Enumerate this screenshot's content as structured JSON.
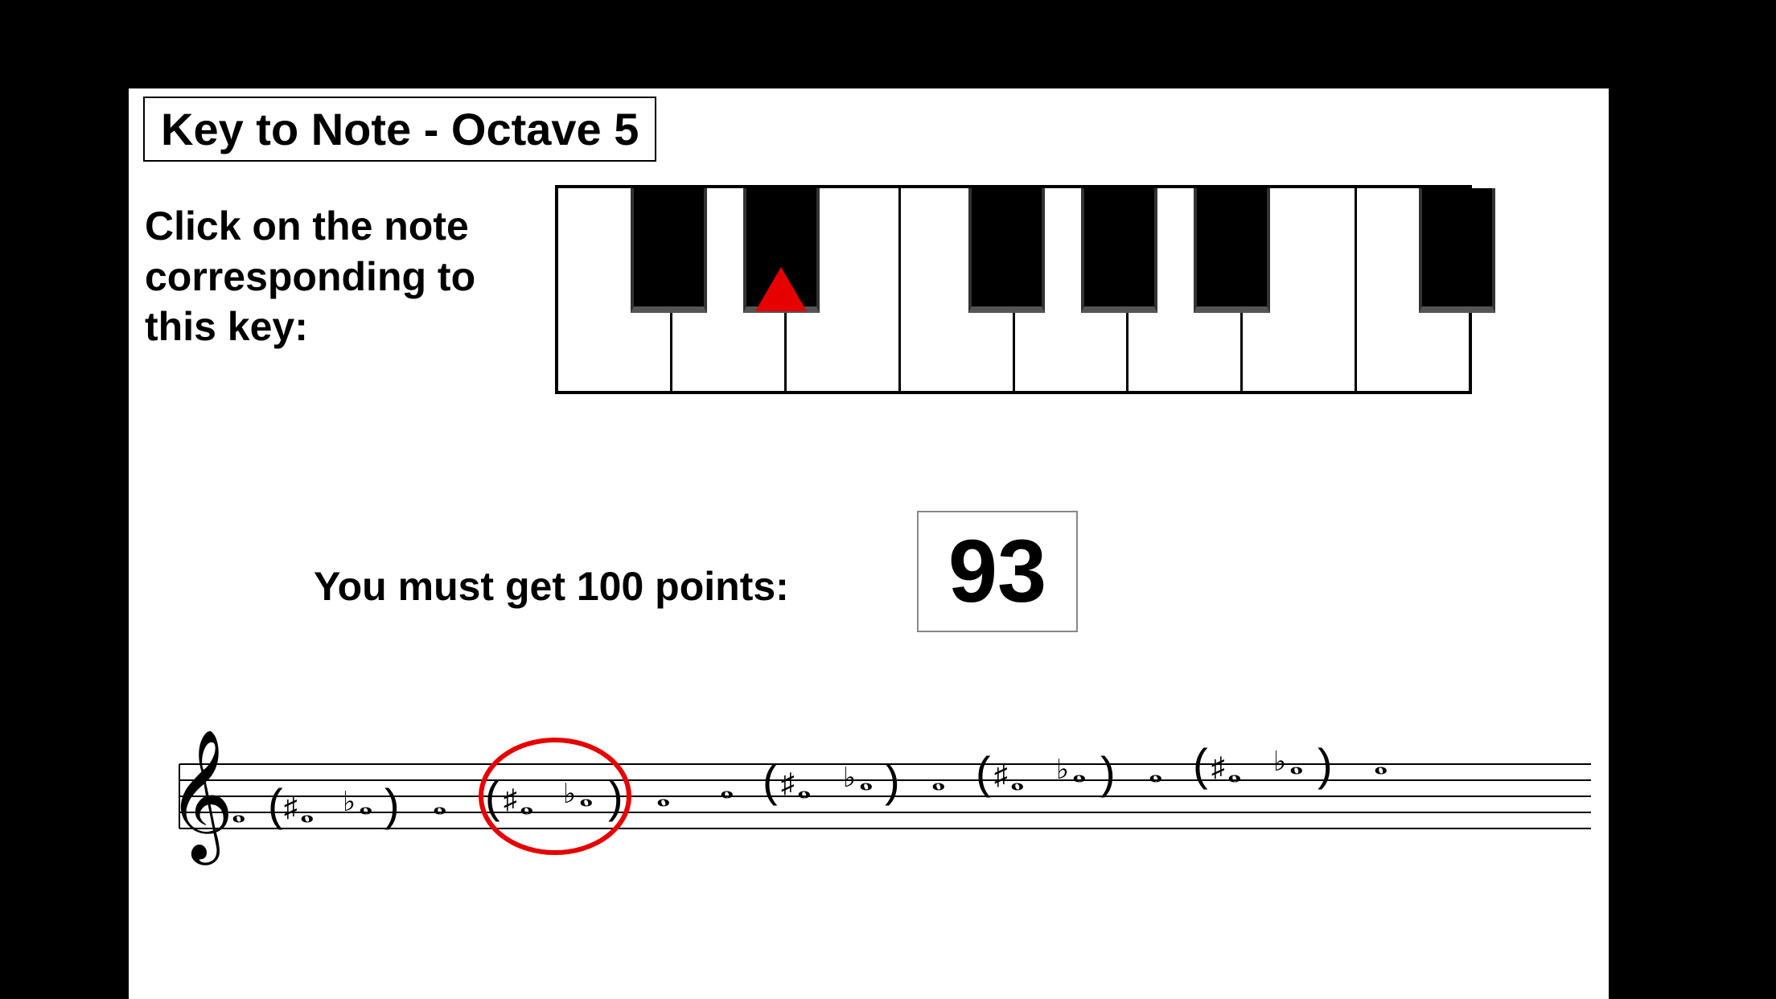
{
  "title": "Key to Note - Octave 5",
  "instruction": "Click on the note corresponding to this key:",
  "points_label": "You must get 100 points:",
  "score": "93",
  "marker_key": "black-2",
  "highlighted_note_index": 1
}
